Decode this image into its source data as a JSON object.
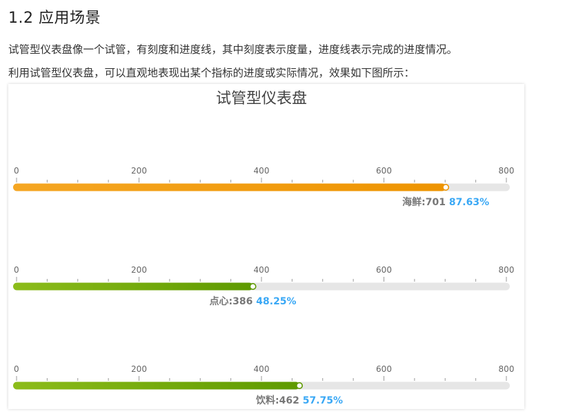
{
  "section": {
    "heading": "1.2 应用场景"
  },
  "paragraphs": [
    "试管型仪表盘像一个试管，有刻度和进度线，其中刻度表示度量，进度线表示完成的进度情况。",
    "利用试管型仪表盘，可以直观地表现出某个指标的进度或实际情况，效果如下图所示："
  ],
  "chart_data": {
    "type": "bar",
    "title": "试管型仪表盘",
    "xlim": [
      0,
      800
    ],
    "ticks": [
      0,
      200,
      400,
      600,
      800
    ],
    "categories": [
      "海鲜",
      "点心",
      "饮料"
    ],
    "values": [
      701,
      386,
      462
    ],
    "percents": [
      "87.63%",
      "48.25%",
      "57.75%"
    ],
    "colors": [
      [
        "#f5a623",
        "#ee9400"
      ],
      [
        "#8cbc1a",
        "#5e9a00"
      ],
      [
        "#8cbc1a",
        "#5e9a00"
      ]
    ],
    "track_color": "#e6e6e6",
    "percent_color": "#3aa8f5"
  }
}
